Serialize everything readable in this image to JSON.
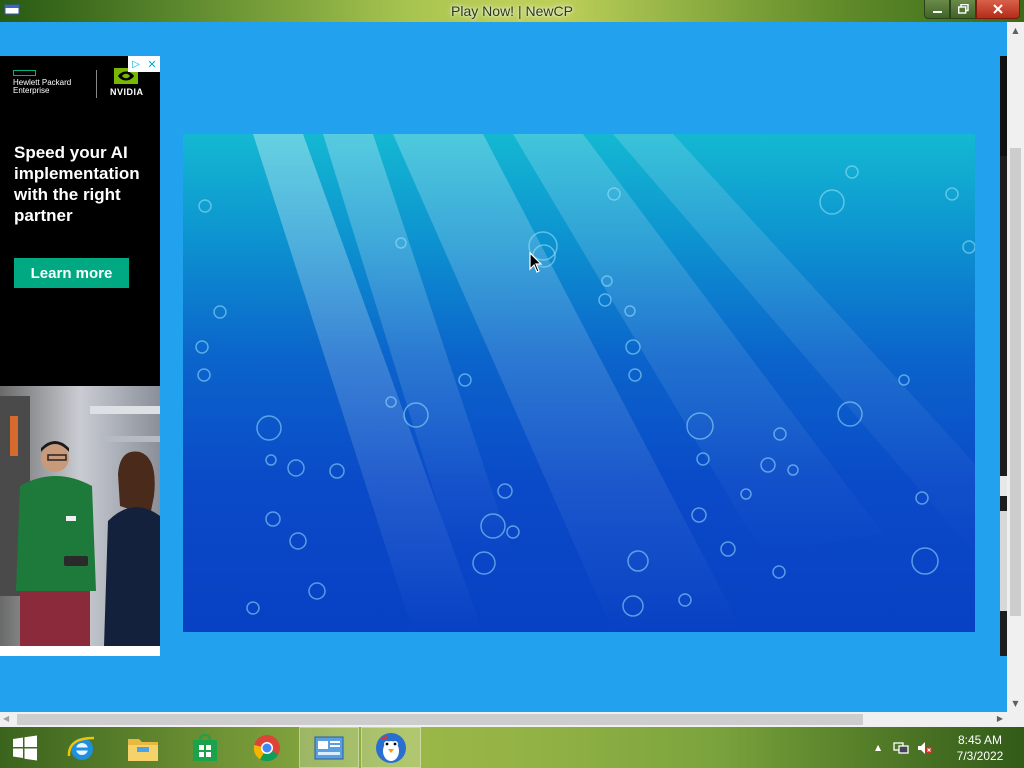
{
  "window": {
    "title": "Play Now! | NewCP",
    "app_icon": "newcp-app-icon",
    "controls": [
      "minimize-icon",
      "restore-icon",
      "close-icon"
    ]
  },
  "ad": {
    "brands": [
      "Hewlett Packard Enterprise",
      "NVIDIA"
    ],
    "hpe_line1": "Hewlett Packard",
    "hpe_line2": "Enterprise",
    "nvidia_label": "NVIDIA",
    "adchoices_icon": "adchoices-icon",
    "close_glyph": "✕",
    "headline": "Speed your AI implementation with the right partner",
    "cta": "Learn more",
    "accent_color": "#01a982"
  },
  "game": {
    "background": "underwater-scene-with-bubbles",
    "colors": {
      "top": "#14b8d2",
      "bottom": "#0841c4"
    }
  },
  "page": {
    "background_color": "#22a1ef"
  },
  "taskbar": {
    "items": [
      {
        "name": "start-button",
        "icon": "windows-logo-icon"
      },
      {
        "name": "internet-explorer",
        "icon": "ie-icon"
      },
      {
        "name": "file-explorer",
        "icon": "folder-icon"
      },
      {
        "name": "windows-store",
        "icon": "store-icon"
      },
      {
        "name": "google-chrome",
        "icon": "chrome-icon"
      },
      {
        "name": "control-panel",
        "icon": "control-panel-icon"
      },
      {
        "name": "newcp-app",
        "icon": "penguin-icon",
        "active": true
      }
    ],
    "tray_icons": [
      "show-hidden-icons-icon",
      "network-icon",
      "volume-muted-icon"
    ],
    "time": "8:45 AM",
    "date": "7/3/2022"
  }
}
